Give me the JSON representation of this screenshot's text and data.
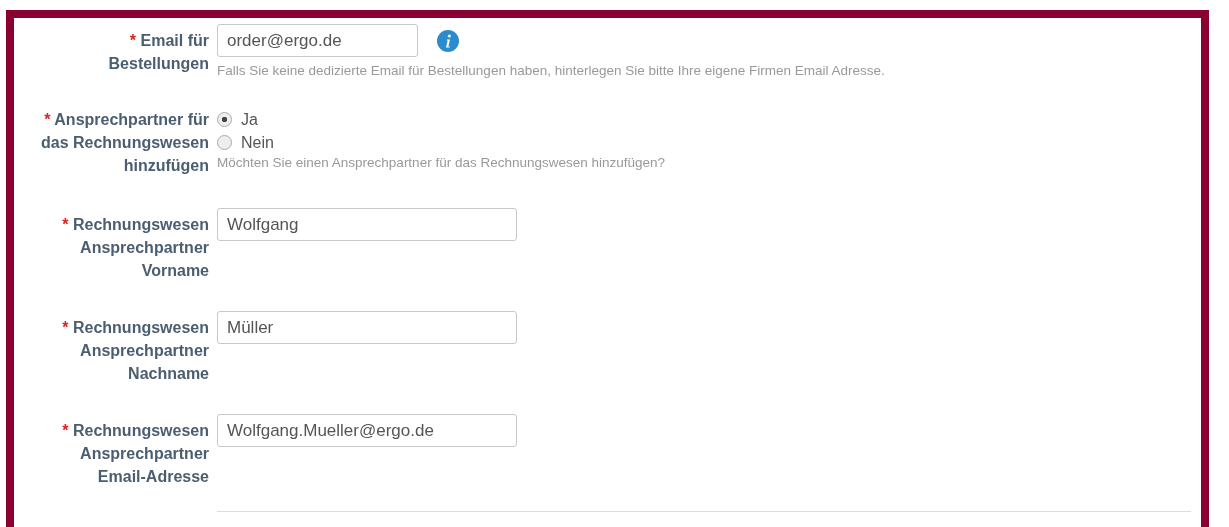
{
  "fields": [
    {
      "kind": "text",
      "required_mark": "*",
      "label": "Email für Bestellungen",
      "value": "order@ergo.de",
      "info": true,
      "short": true,
      "hint": "Falls Sie keine dedizierte Email für Bestellungen haben, hinterlegen Sie bitte Ihre eigene Firmen Email Adresse."
    },
    {
      "kind": "radio",
      "required_mark": "*",
      "label": "Ansprechpartner für das Rechnungswesen hinzufügen",
      "options": [
        {
          "label": "Ja",
          "selected": true
        },
        {
          "label": "Nein",
          "selected": false
        }
      ],
      "hint": "Möchten Sie einen Ansprechpartner für das Rechnungswesen hinzufügen?"
    },
    {
      "kind": "text",
      "required_mark": "*",
      "label": "Rechnungswesen Ansprechpartner Vorname",
      "value": "Wolfgang"
    },
    {
      "kind": "text",
      "required_mark": "*",
      "label": "Rechnungswesen Ansprechpartner Nachname",
      "value": "Müller"
    },
    {
      "kind": "text",
      "required_mark": "*",
      "label": "Rechnungswesen Ansprechpartner Email-Adresse",
      "value": "Wolfgang.Mueller@ergo.de"
    }
  ]
}
